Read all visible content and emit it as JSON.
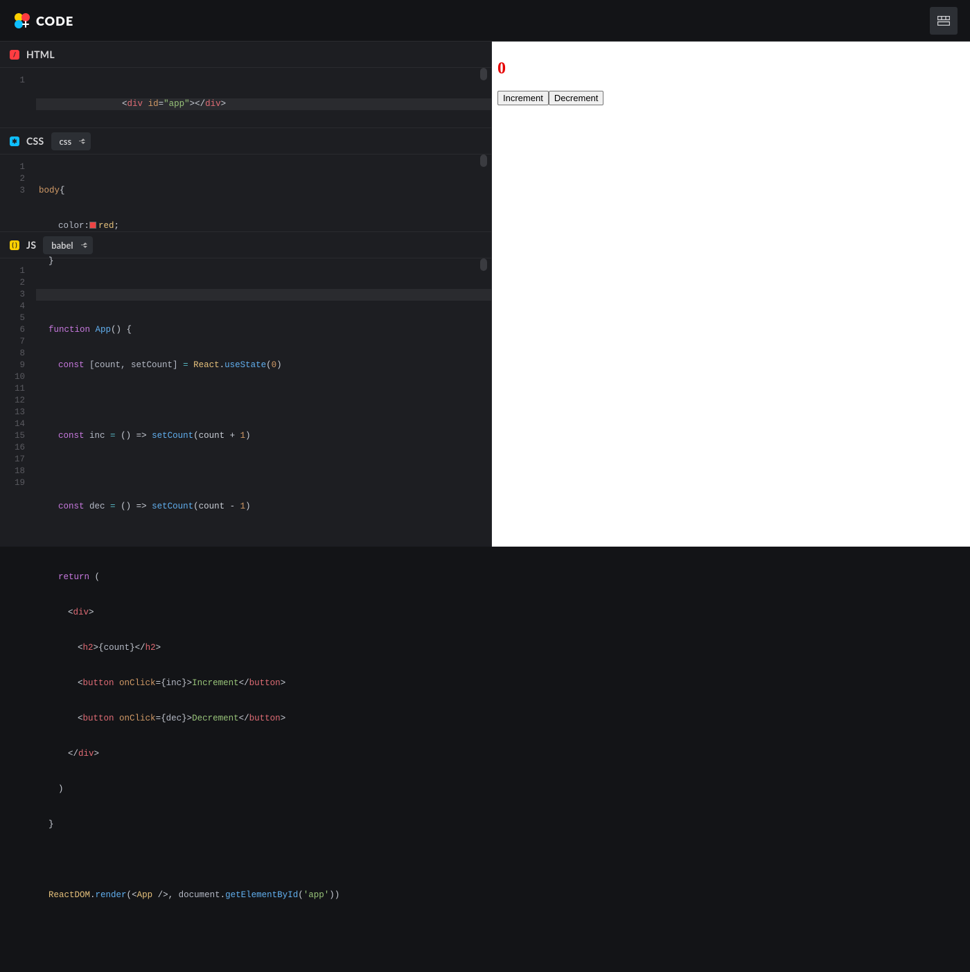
{
  "header": {
    "title": "CODE"
  },
  "html_panel": {
    "title": "HTML",
    "line_numbers": [
      "1"
    ]
  },
  "html_code": {
    "l1": {
      "lt1": "<",
      "tag1": "div",
      "sp": " ",
      "attr": "id",
      "eq": "=",
      "str": "\"app\"",
      "gt1": "></",
      "tag2": "div",
      "gt2": ">"
    }
  },
  "css_panel": {
    "title": "CSS",
    "select": "css",
    "line_numbers": [
      "1",
      "2",
      "3"
    ]
  },
  "css_code": {
    "l1": {
      "sel": "body",
      "brace": "{"
    },
    "l2": {
      "prop": "color",
      "colon": ":",
      "val": "red",
      "semi": ";"
    },
    "l3": {
      "brace": "}"
    }
  },
  "js_panel": {
    "title": "JS",
    "select": "babel",
    "line_numbers": [
      "1",
      "2",
      "3",
      "4",
      "5",
      "6",
      "7",
      "8",
      "9",
      "10",
      "11",
      "12",
      "13",
      "14",
      "15",
      "16",
      "17",
      "18",
      "19"
    ]
  },
  "js_code": {
    "l2": {
      "kwd": "function",
      "sp": " ",
      "name": "App",
      "paren": "() {"
    },
    "l3": {
      "kwd": "const",
      "sp": " ",
      "destr": "[count, setCount] ",
      "eq": "= ",
      "react": "React",
      "dot": ".",
      "hook": "useState",
      "call": "(",
      "num": "0",
      "end": ")"
    },
    "l5": {
      "kwd": "const",
      "sp": " ",
      "name": "inc ",
      "eq": "= ",
      "arrow": "() => ",
      "fn": "setCount",
      "call": "(count + ",
      "num": "1",
      "end": ")"
    },
    "l7": {
      "kwd": "const",
      "sp": " ",
      "name": "dec ",
      "eq": "= ",
      "arrow": "() => ",
      "fn": "setCount",
      "call": "(count - ",
      "num": "1",
      "end": ")"
    },
    "l9": {
      "kwd": "return",
      "sp": " ",
      "paren": "("
    },
    "l10": {
      "lt": "<",
      "tag": "div",
      "gt": ">"
    },
    "l11": {
      "lt": "<",
      "tag": "h2",
      "gt": ">",
      "exprL": "{",
      "var": "count",
      "exprR": "}",
      "lt2": "</",
      "tag2": "h2",
      "gt2": ">"
    },
    "l12": {
      "lt": "<",
      "tag": "button",
      "sp": " ",
      "attr": "onClick",
      "eq": "=",
      "cbL": "{",
      "var": "inc",
      "cbR": "}",
      "gt": ">",
      "txt": "Increment",
      "lt2": "</",
      "tag2": "button",
      "gt2": ">"
    },
    "l13": {
      "lt": "<",
      "tag": "button",
      "sp": " ",
      "attr": "onClick",
      "eq": "=",
      "cbL": "{",
      "var": "dec",
      "cbR": "}",
      "gt": ">",
      "txt": "Decrement",
      "lt2": "</",
      "tag2": "button",
      "gt2": ">"
    },
    "l14": {
      "lt": "</",
      "tag": "div",
      "gt": ">"
    },
    "l15": {
      "paren": ")"
    },
    "l16": {
      "brace": "}"
    },
    "l18": {
      "obj": "ReactDOM",
      "dot": ".",
      "fn": "render",
      "call": "(",
      "lt": "<",
      "comp": "App",
      "sp": " ",
      "close": "/>",
      "comma": ", ",
      "doc": "document",
      "dot2": ".",
      "fn2": "getElementById",
      "call2": "(",
      "str": "'app'",
      "end": "))"
    }
  },
  "preview": {
    "count": "0",
    "btn_inc": "Increment",
    "btn_dec": "Decrement"
  }
}
